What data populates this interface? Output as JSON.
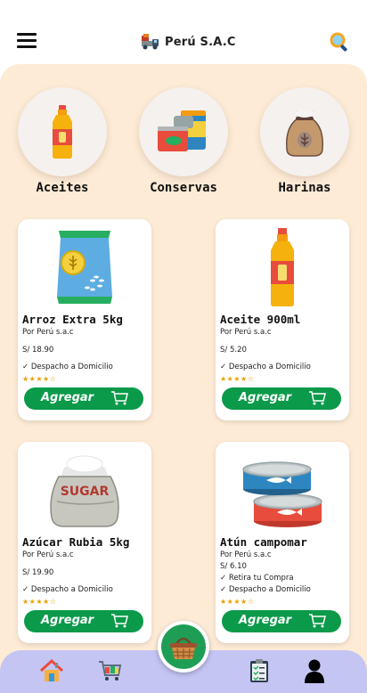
{
  "header": {
    "title": "Perú S.A.C",
    "menu_icon": "hamburger-menu-icon",
    "logo_icon": "delivery-truck-icon",
    "search_icon": "search-icon"
  },
  "categories": [
    {
      "label": "Aceites",
      "icon": "oil-bottle-icon"
    },
    {
      "label": "Conservas",
      "icon": "canned-food-icon"
    },
    {
      "label": "Harinas",
      "icon": "flour-sack-icon"
    }
  ],
  "products": [
    {
      "name": "Arroz Extra 5kg",
      "seller": "Por Perú s.a.c",
      "price": "S/ 18.90",
      "features": [
        "✓ Despacho a Domicilio"
      ],
      "stars": "★★★★☆",
      "rating": 4,
      "button": "Agregar",
      "icon": "rice-bag-icon"
    },
    {
      "name": "Aceite 900ml",
      "seller": "Por Perú s.a.c",
      "price": "S/ 5.20",
      "features": [
        "✓ Despacho a Domicilio"
      ],
      "stars": "★★★★☆",
      "rating": 4,
      "button": "Agregar",
      "icon": "oil-bottle-icon"
    },
    {
      "name": "Azúcar Rubia 5kg",
      "seller": "Por Perú s.a.c",
      "price": "S/ 19.90",
      "features": [
        "✓ Despacho a Domicilio"
      ],
      "stars": "★★★★☆",
      "rating": 4,
      "button": "Agregar",
      "icon": "sugar-sack-icon",
      "sack_text": "SUGAR"
    },
    {
      "name": "Atún campomar",
      "seller": "Por Perú s.a.c",
      "price": "S/ 6.10",
      "features": [
        "✓ Retira tu Compra",
        "✓ Despacho a Domicilio"
      ],
      "stars": "★★★★☆",
      "rating": 4,
      "button": "Agregar",
      "icon": "tuna-cans-icon"
    }
  ],
  "bottom_nav": {
    "items": [
      {
        "name": "home",
        "icon": "home-icon"
      },
      {
        "name": "store",
        "icon": "store-cart-icon"
      },
      {
        "name": "basket",
        "icon": "basket-icon"
      },
      {
        "name": "orders",
        "icon": "clipboard-icon"
      },
      {
        "name": "profile",
        "icon": "user-icon"
      }
    ]
  },
  "colors": {
    "accent_green": "#0a9a4a",
    "background_peach": "#fdebd6",
    "nav_lavender": "#c5c5f3",
    "star_gold": "#e6a100"
  }
}
